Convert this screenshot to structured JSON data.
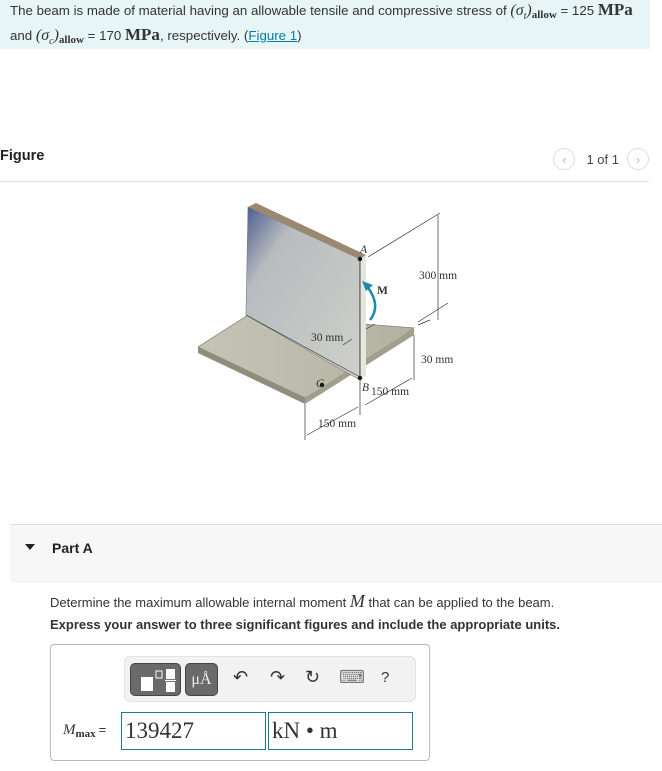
{
  "intro": {
    "line1_prefix": "The beam is made of material having an allowable tensile and compressive stress of ",
    "sigma_t": "(σ",
    "t_sub": "t",
    "close_paren": ")",
    "allow_sub": "allow",
    "eq1": " = 125 ",
    "unit": "MPa",
    "line2_prefix": "and ",
    "sigma_c": "(σ",
    "c_sub": "c",
    "eq2": " = 170 ",
    "line2_suffix": ", respectively. (",
    "figure_link": "Figure 1",
    "end_paren": ")"
  },
  "figure_panel": {
    "title": "Figure",
    "page_indicator": "1 of 1",
    "prev_icon": "‹",
    "next_icon": "›",
    "labels": {
      "A": "A",
      "B": "B",
      "C": "C",
      "M": "M",
      "height": "300 mm",
      "web_thickness": "30 mm",
      "flange_thickness": "30 mm",
      "flange_right": "150 mm",
      "flange_left": "150 mm"
    }
  },
  "part": {
    "title": "Part A",
    "question_prefix": "Determine the maximum allowable internal moment ",
    "question_var": "M",
    "question_suffix": " that can be applied to the beam.",
    "instruction": "Express your answer to three significant figures and include the appropriate units."
  },
  "answer": {
    "label_var": "M",
    "label_sub": "max",
    "label_eq": "=",
    "value": "139427",
    "units": "kN • m",
    "toolbar": {
      "templates_icon": "templates-icon",
      "units_label": "μÅ",
      "undo_icon": "↶",
      "redo_icon": "↷",
      "reset_icon": "↻",
      "keyboard_icon": "⌨",
      "help_label": "?"
    }
  }
}
